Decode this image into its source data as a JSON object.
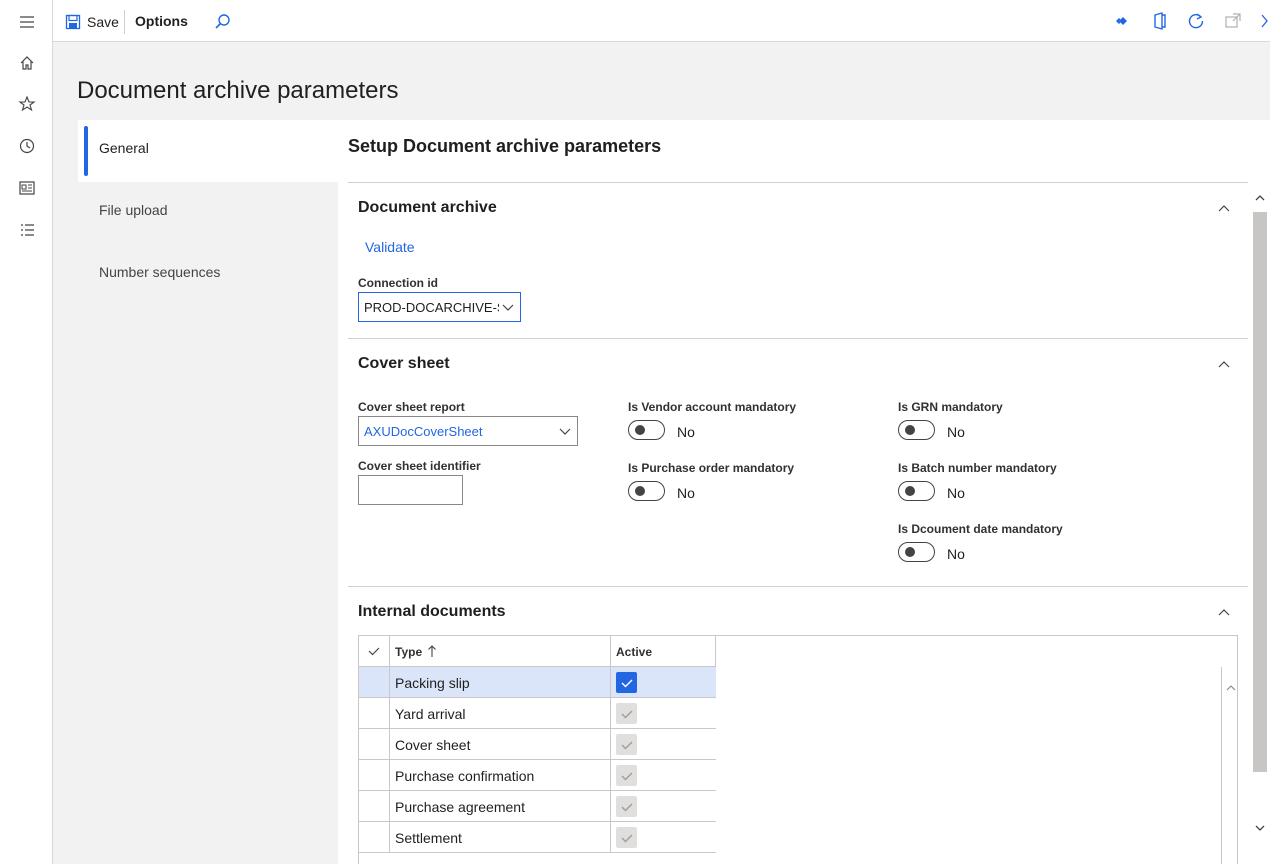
{
  "toolbar": {
    "save_label": "Save",
    "options_label": "Options"
  },
  "page": {
    "title": "Document archive parameters"
  },
  "tabs": [
    {
      "label": "General",
      "active": true
    },
    {
      "label": "File upload",
      "active": false
    },
    {
      "label": "Number sequences",
      "active": false
    }
  ],
  "content": {
    "title": "Setup Document archive parameters",
    "document_archive": {
      "title": "Document archive",
      "validate_label": "Validate",
      "connection_label": "Connection id",
      "connection_value": "PROD-DOCARCHIVE-S"
    },
    "cover_sheet": {
      "title": "Cover sheet",
      "report_label": "Cover sheet report",
      "report_value": "AXUDocCoverSheet",
      "identifier_label": "Cover sheet identifier",
      "identifier_value": "",
      "vendor_label": "Is Vendor account mandatory",
      "vendor_value": "No",
      "po_label": "Is Purchase order mandatory",
      "po_value": "No",
      "grn_label": "Is GRN mandatory",
      "grn_value": "No",
      "batch_label": "Is Batch number mandatory",
      "batch_value": "No",
      "docdate_label": "Is Dcoument date mandatory",
      "docdate_value": "No"
    },
    "internal_documents": {
      "title": "Internal documents",
      "col_type": "Type",
      "col_active": "Active",
      "rows": [
        {
          "type": "Packing slip",
          "active": true,
          "selected": true
        },
        {
          "type": "Yard arrival",
          "active": true,
          "selected": false
        },
        {
          "type": "Cover sheet",
          "active": true,
          "selected": false
        },
        {
          "type": "Purchase confirmation",
          "active": true,
          "selected": false
        },
        {
          "type": "Purchase agreement",
          "active": true,
          "selected": false
        },
        {
          "type": "Settlement",
          "active": true,
          "selected": false
        }
      ]
    }
  },
  "colors": {
    "accent": "#2266e3",
    "selected_row": "#dae5f9"
  }
}
